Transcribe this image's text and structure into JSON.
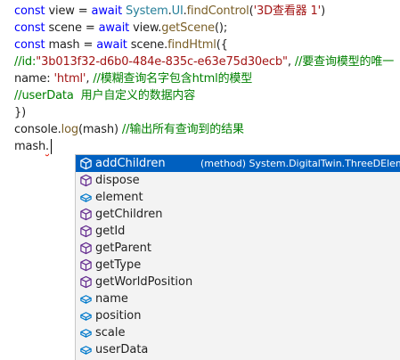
{
  "code": {
    "line1": {
      "kw": "const",
      "t1": " view = ",
      "kw2": "await",
      "t2": " ",
      "ty1": "System",
      "t3": ".",
      "ty2": "UI",
      "t4": ".",
      "fn": "findControl",
      "t5": "(",
      "str": "'3D查看器 1'",
      "t6": ")"
    },
    "line2": {
      "kw": "const",
      "t1": " scene = ",
      "kw2": "await",
      "t2": " view.",
      "fn": "getScene",
      "t3": "();"
    },
    "line3": {
      "kw": "const",
      "t1": " mash = ",
      "kw2": "await",
      "t2": " scene.",
      "fn": "findHtml",
      "t3": "({"
    },
    "line4": {
      "cm1": "//id:",
      "str": "\"3b013f32-d6b0-484e-835c-e63e75d30ecb\"",
      "t1": ", ",
      "cm2": "//要查询模型的唯一"
    },
    "line5": {
      "t1": "name: ",
      "str": "'html'",
      "t2": ", ",
      "cm": "//模糊查询名字包含html的模型"
    },
    "line6": {
      "cm": "//userData  用户自定义的数据内容"
    },
    "line7": {
      "t1": "})"
    },
    "line8": {
      "t1": "console.",
      "fn": "log",
      "t2": "(mash) ",
      "cm": "//输出所有查询到的结果"
    },
    "line9": {
      "t1": "mash",
      "t2": "."
    }
  },
  "suggest": {
    "selected_detail": "(method) System.DigitalTwin.ThreeDElement.",
    "items": [
      {
        "label": "addChildren",
        "kind": "method"
      },
      {
        "label": "dispose",
        "kind": "method"
      },
      {
        "label": "element",
        "kind": "field"
      },
      {
        "label": "getChildren",
        "kind": "method"
      },
      {
        "label": "getId",
        "kind": "method"
      },
      {
        "label": "getParent",
        "kind": "method"
      },
      {
        "label": "getType",
        "kind": "method"
      },
      {
        "label": "getWorldPosition",
        "kind": "method"
      },
      {
        "label": "name",
        "kind": "field"
      },
      {
        "label": "position",
        "kind": "field"
      },
      {
        "label": "scale",
        "kind": "field"
      },
      {
        "label": "userData",
        "kind": "field"
      }
    ]
  },
  "colors": {
    "keyword": "#0000ff",
    "function": "#795e26",
    "type": "#267f99",
    "string": "#a31515",
    "comment": "#008000",
    "method_icon": "#652d90",
    "field_icon": "#007acc",
    "selection": "#0060c0"
  }
}
